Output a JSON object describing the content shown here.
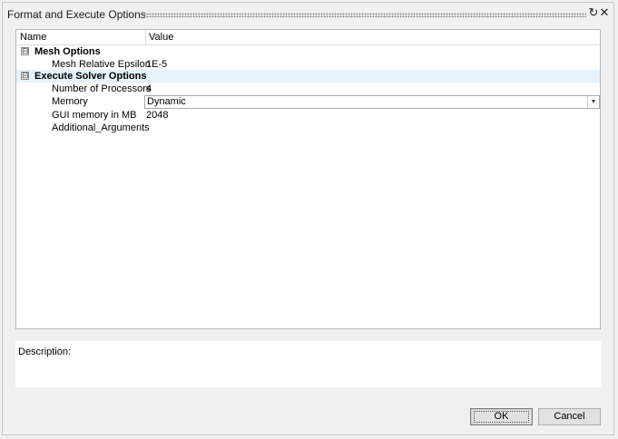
{
  "window": {
    "title": "Format and Execute Options"
  },
  "grid": {
    "columns": [
      "Name",
      "Value"
    ],
    "groups": [
      {
        "label": "Mesh Options",
        "expander": "⊟",
        "properties": [
          {
            "name": "Mesh Relative Epsilon",
            "value": "1E-5"
          }
        ]
      },
      {
        "label": "Execute Solver Options",
        "expander": "⊟",
        "properties": [
          {
            "name": "Number of Processors",
            "value": "4"
          },
          {
            "name": "Memory",
            "value": "Dynamic"
          },
          {
            "name": "GUI memory in MB",
            "value": "2048"
          },
          {
            "name": "Additional_Arguments",
            "value": ""
          }
        ]
      }
    ]
  },
  "description": {
    "label": "Description:"
  },
  "buttons": {
    "ok": "OK",
    "cancel": "Cancel"
  },
  "icons": {
    "refresh": "refresh-icon",
    "close": "close-icon",
    "dropdown": "chevron-down-icon"
  },
  "colors": {
    "selected_row": "#e5f3fb",
    "dialog_bg": "#f0f0f0"
  }
}
